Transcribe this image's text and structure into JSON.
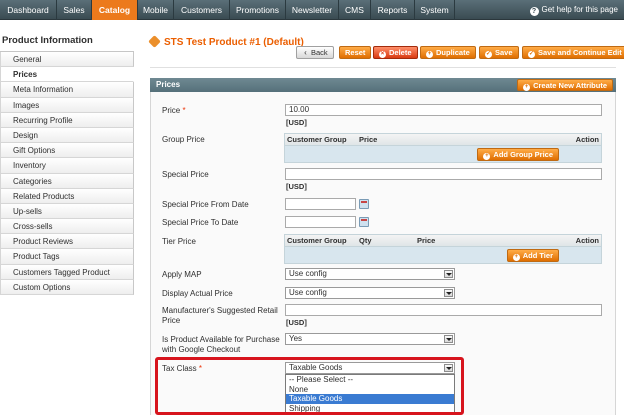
{
  "nav": {
    "items": [
      {
        "label": "Dashboard",
        "active": false
      },
      {
        "label": "Sales",
        "active": false
      },
      {
        "label": "Catalog",
        "active": true
      },
      {
        "label": "Mobile",
        "active": false
      },
      {
        "label": "Customers",
        "active": false
      },
      {
        "label": "Promotions",
        "active": false
      },
      {
        "label": "Newsletter",
        "active": false
      },
      {
        "label": "CMS",
        "active": false
      },
      {
        "label": "Reports",
        "active": false
      },
      {
        "label": "System",
        "active": false
      }
    ],
    "help_label": "Get help for this page"
  },
  "sidebar": {
    "title": "Product Information",
    "items": [
      {
        "label": "General",
        "active": false
      },
      {
        "label": "Prices",
        "active": true
      },
      {
        "label": "Meta Information",
        "active": false
      },
      {
        "label": "Images",
        "active": false
      },
      {
        "label": "Recurring Profile",
        "active": false
      },
      {
        "label": "Design",
        "active": false
      },
      {
        "label": "Gift Options",
        "active": false
      },
      {
        "label": "Inventory",
        "active": false
      },
      {
        "label": "Categories",
        "active": false
      },
      {
        "label": "Related Products",
        "active": false
      },
      {
        "label": "Up-sells",
        "active": false
      },
      {
        "label": "Cross-sells",
        "active": false
      },
      {
        "label": "Product Reviews",
        "active": false
      },
      {
        "label": "Product Tags",
        "active": false
      },
      {
        "label": "Customers Tagged Product",
        "active": false
      },
      {
        "label": "Custom Options",
        "active": false
      }
    ]
  },
  "header": {
    "title": "STS Test Product #1 (Default)",
    "buttons": {
      "back": "Back",
      "reset": "Reset",
      "delete": "Delete",
      "duplicate": "Duplicate",
      "save": "Save",
      "save_continue": "Save and Continue Edit"
    }
  },
  "prices": {
    "section_title": "Prices",
    "create_attribute": "Create New Attribute",
    "price": {
      "label": "Price",
      "required": "*",
      "value": "10.00",
      "note": "[USD]"
    },
    "group_price": {
      "label": "Group Price",
      "columns": {
        "group": "Customer Group",
        "price": "Price",
        "action": "Action"
      },
      "add_button": "Add Group Price"
    },
    "special_price": {
      "label": "Special Price",
      "value": "",
      "note": "[USD]"
    },
    "special_from": {
      "label": "Special Price From Date",
      "value": ""
    },
    "special_to": {
      "label": "Special Price To Date",
      "value": ""
    },
    "tier_price": {
      "label": "Tier Price",
      "columns": {
        "group": "Customer Group",
        "qty": "Qty",
        "price": "Price",
        "action": "Action"
      },
      "add_button": "Add Tier"
    },
    "apply_map": {
      "label": "Apply MAP",
      "value": "Use config"
    },
    "display_actual": {
      "label": "Display Actual Price",
      "value": "Use config"
    },
    "msrp": {
      "label_line1": "Manufacturer's Suggested Retail",
      "label_line2": "Price",
      "value": "",
      "note": "[USD]"
    },
    "google_checkout": {
      "label_line1": "Is Product Available for Purchase",
      "label_line2": "with Google Checkout",
      "value": "Yes"
    },
    "tax_class": {
      "label": "Tax Class",
      "required": "*",
      "value": "Taxable Goods",
      "options": [
        "-- Please Select --",
        "None",
        "Taxable Goods",
        "Shipping"
      ],
      "selected_index": 2
    }
  },
  "colors": {
    "accent": "#ec7a1c",
    "title": "#eb5e00",
    "highlight": "#d7141d"
  }
}
